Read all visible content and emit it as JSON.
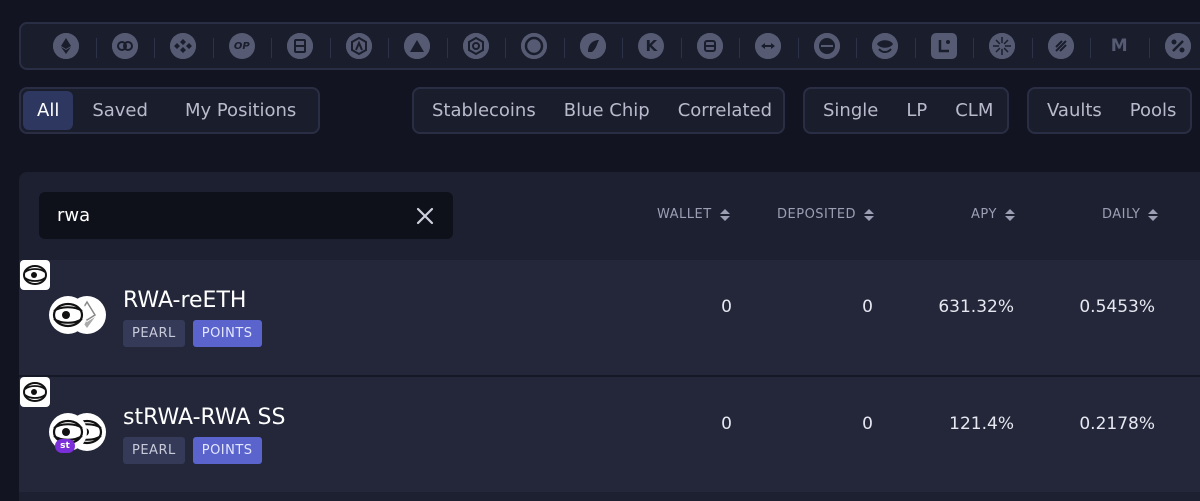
{
  "chains": [
    {
      "name": "ethereum-icon"
    },
    {
      "name": "optimism-circle-icon"
    },
    {
      "name": "bnb-chain-icon"
    },
    {
      "name": "op-icon",
      "label": "OP"
    },
    {
      "name": "fantom-icon"
    },
    {
      "name": "arbitrum-icon"
    },
    {
      "name": "avalanche-icon"
    },
    {
      "name": "celo-icon"
    },
    {
      "name": "moonbeam-icon"
    },
    {
      "name": "kava-icon"
    },
    {
      "name": "kcc-icon",
      "label": "K"
    },
    {
      "name": "cronos-icon"
    },
    {
      "name": "bridge-icon"
    },
    {
      "name": "canto-icon"
    },
    {
      "name": "base-icon"
    },
    {
      "name": "linea-icon"
    },
    {
      "name": "scroll-icon"
    },
    {
      "name": "zksync-icon"
    },
    {
      "name": "mantle-icon",
      "label": "M"
    },
    {
      "name": "fraxtal-icon"
    }
  ],
  "filters": {
    "ownership": [
      "All",
      "Saved",
      "My Positions"
    ],
    "category": [
      "Stablecoins",
      "Blue Chip",
      "Correlated"
    ],
    "asset_type": [
      "Single",
      "LP",
      "CLM"
    ],
    "vault_type": [
      "Vaults",
      "Pools"
    ]
  },
  "search": {
    "value": "rwa"
  },
  "columns": {
    "wallet": "WALLET",
    "deposited": "DEPOSITED",
    "apy": "APY",
    "daily": "DAILY"
  },
  "rows": [
    {
      "name": "RWA-reETH",
      "platform": "PEARL",
      "badge": "POINTS",
      "wallet": "0",
      "deposited": "0",
      "apy": "631.32%",
      "daily": "0.5453%"
    },
    {
      "name": "stRWA-RWA SS",
      "platform": "PEARL",
      "badge": "POINTS",
      "st_label": "st",
      "wallet": "0",
      "deposited": "0",
      "apy": "121.4%",
      "daily": "0.2178%"
    }
  ],
  "colors": {
    "background": "#121521",
    "panel": "#1c2031",
    "active_filter": "#2e3760",
    "points_tag": "#5a64cc",
    "platform_tag": "#343a57"
  }
}
